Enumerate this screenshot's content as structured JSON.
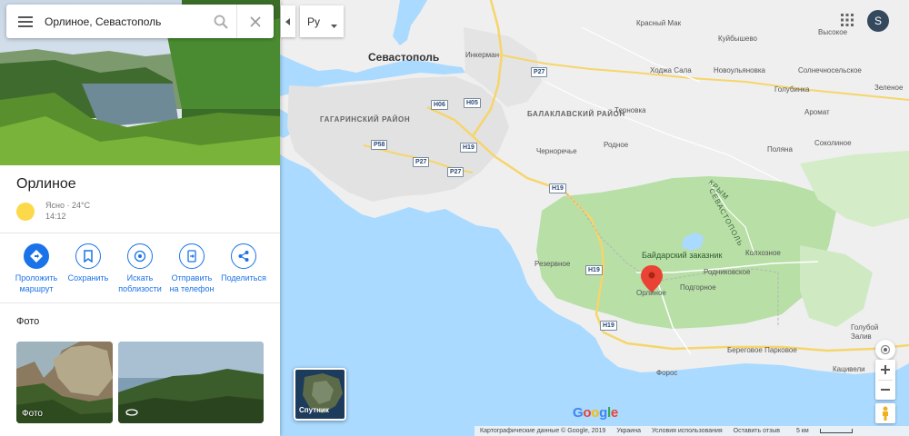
{
  "search": {
    "value": "Орлиное, Севастополь"
  },
  "place": {
    "title": "Орлиное",
    "weather_condition": "Ясно · 24°C",
    "weather_time": "14:12"
  },
  "actions": [
    {
      "label": "Проложить маршрут",
      "icon": "directions-icon"
    },
    {
      "label": "Сохранить",
      "icon": "bookmark-icon"
    },
    {
      "label": "Искать поблизости",
      "icon": "nearby-icon"
    },
    {
      "label": "Отправить на телефон",
      "icon": "send-to-phone-icon"
    },
    {
      "label": "Поделиться",
      "icon": "share-icon"
    }
  ],
  "photos": {
    "heading": "Фото",
    "items": [
      {
        "label": "Фото"
      },
      {
        "label": ""
      }
    ]
  },
  "language": {
    "selected": "Ру"
  },
  "user": {
    "initial": "S"
  },
  "satellite": {
    "label": "Спутник"
  },
  "google_logo": "Google",
  "footer": {
    "copyright": "Картографические данные © Google, 2019",
    "country": "Украина",
    "terms": "Условия использования",
    "feedback": "Оставить отзыв",
    "scale": "5 км"
  },
  "map": {
    "places": {
      "sevastopol": "Севастополь",
      "inkerman": "Инкерман",
      "gagarinsky": "ГАГАРИНСКИЙ РАЙОН",
      "balaklavsky": "БАЛАКЛАВСКИЙ РАЙОН",
      "krasny_mak": "Красный Мак",
      "kuibyshevo": "Куйбышево",
      "vysokoe": "Высокое",
      "hodja_sala": "Ходжа Сала",
      "novulyanovka": "Новоульяновка",
      "solnechnoselye": "Солнечносельское",
      "golubinka": "Голубинка",
      "zelenoe": "Зеленое",
      "ternovka": "Терновка",
      "aromat": "Аромат",
      "rodnoe": "Родное",
      "sokolinoe": "Соколиное",
      "chernorechye": "Черноречье",
      "polyana": "Поляна",
      "rezervnoe": "Резервное",
      "baidarsky": "Байдарский заказник",
      "kolhoznoe": "Колхозное",
      "rodnikovskoe": "Родниковское",
      "podgornoe": "Подгорное",
      "orlinoe": "Орлиное",
      "golubaya_zaliv": "Голубой Залив",
      "beregovoe": "Береговое Парковое",
      "foros": "Форос",
      "katsiveli": "Кацивели",
      "krym": "КРЫМ",
      "sevastopol_ridge": "СЕВАСТОПОЛЬ"
    },
    "roads": [
      "Н06",
      "Н05",
      "Р27",
      "Н19",
      "Р58",
      "Р27",
      "Р27",
      "Н19",
      "Н19",
      "Н19"
    ]
  }
}
